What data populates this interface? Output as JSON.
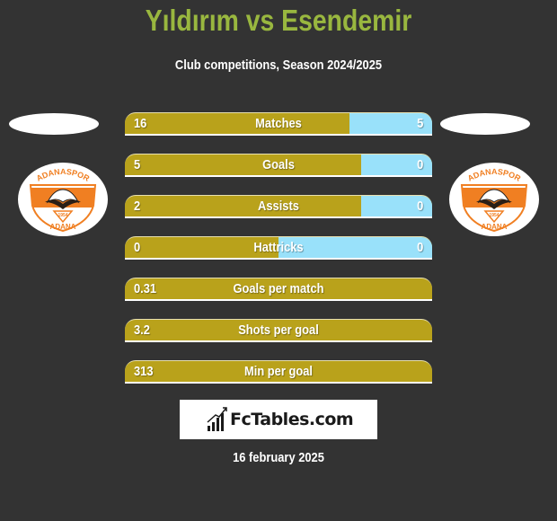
{
  "header": {
    "title": "Yıldırım vs Esendemir",
    "subtitle": "Club competitions, Season 2024/2025"
  },
  "teams": {
    "left": {
      "logo": "adanaspor-crest-icon",
      "logo_text_top": "ADANASPOR",
      "logo_text_bottom": "ADANA",
      "logo_year": "1954"
    },
    "right": {
      "logo": "adanaspor-crest-icon",
      "logo_text_top": "ADANASPOR",
      "logo_text_bottom": "ADANA",
      "logo_year": "1954"
    }
  },
  "colors": {
    "title": "#99b73f",
    "left_bar": "#b9a21b",
    "right_bar": "#99e1fa",
    "background": "#333333",
    "crest_orange": "#f07f22"
  },
  "stats": [
    {
      "label": "Matches",
      "left": "16",
      "right": "5",
      "right_share": 0.27
    },
    {
      "label": "Goals",
      "left": "5",
      "right": "0",
      "right_share": 0.23
    },
    {
      "label": "Assists",
      "left": "2",
      "right": "0",
      "right_share": 0.23
    },
    {
      "label": "Hattricks",
      "left": "0",
      "right": "0",
      "right_share": 0.5
    },
    {
      "label": "Goals per match",
      "left": "0.31",
      "right": "",
      "right_share": 0
    },
    {
      "label": "Shots per goal",
      "left": "3.2",
      "right": "",
      "right_share": 0
    },
    {
      "label": "Min per goal",
      "left": "313",
      "right": "",
      "right_share": 0
    }
  ],
  "footer": {
    "brand": "FcTables.com",
    "brand_icon": "bar-chart-icon",
    "date": "16 february 2025"
  }
}
